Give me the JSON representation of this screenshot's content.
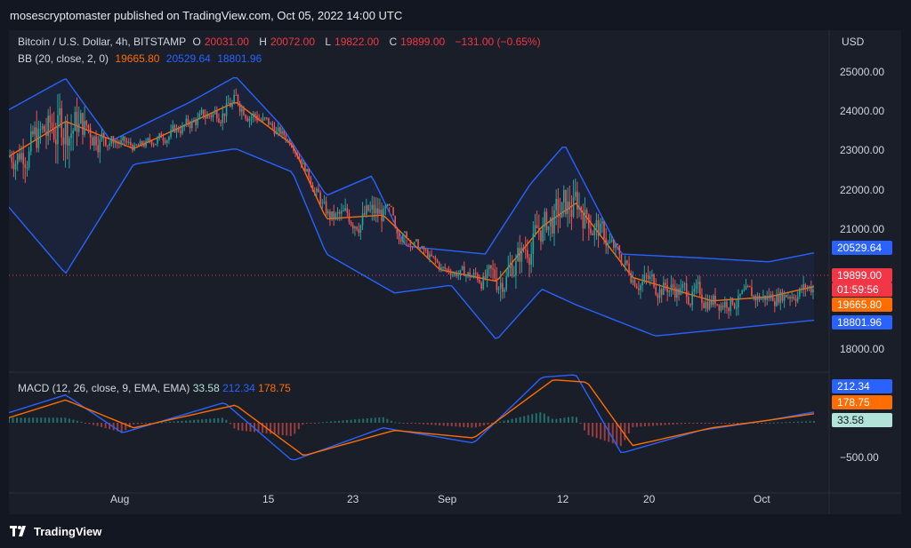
{
  "header": {
    "publisher_text": "mosescryptomaster published on TradingView.com, Oct 05, 2022 14:00 UTC"
  },
  "legend": {
    "symbol": "Bitcoin / U.S. Dollar, 4h, BITSTAMP",
    "open_label": "O",
    "open": "20031.00",
    "high_label": "H",
    "high": "20072.00",
    "low_label": "L",
    "low": "19822.00",
    "close_label": "C",
    "close": "19899.00",
    "change": "−131.00 (−0.65%)",
    "bb_label": "BB (20, close, 2, 0)",
    "bb_basis": "19665.80",
    "bb_upper": "20529.64",
    "bb_lower": "18801.96",
    "macd_label": "MACD (12, 26, close, 9, EMA, EMA)",
    "macd_hist": "33.58",
    "macd_line": "212.34",
    "macd_signal": "178.75"
  },
  "axis": {
    "currency": "USD",
    "price_ticks": [
      "25000.00",
      "24000.00",
      "23000.00",
      "22000.00",
      "21000.00",
      "18000.00"
    ],
    "macd_ticks": [
      "−500.00"
    ],
    "time_ticks": [
      "Aug",
      "15",
      "23",
      "Sep",
      "12",
      "20",
      "Oct"
    ]
  },
  "badges": {
    "bb_upper": "20529.64",
    "close": "19899.00",
    "countdown": "01:59:56",
    "bb_basis": "19665.80",
    "bb_lower": "18801.96",
    "macd_line": "212.34",
    "macd_signal": "178.75",
    "macd_hist": "33.58"
  },
  "footer": {
    "brand": "TradingView"
  },
  "colors": {
    "background": "#1a1e29",
    "band": "#2962ff",
    "basis": "#ff6d00",
    "up": "#26a69a",
    "down": "#ef5350",
    "macd": "#2962ff",
    "signal": "#ff6d00"
  },
  "chart_data": {
    "type": "candlestick",
    "symbol": "BTC/USD",
    "interval": "4h",
    "x_range": [
      "2022-07-26",
      "2022-10-05"
    ],
    "ylim": [
      17700,
      25600
    ],
    "indicators": {
      "bollinger_upper_approx": [
        [
          "2022-07-26",
          24200
        ],
        [
          "2022-07-31",
          25000
        ],
        [
          "2022-08-04",
          23400
        ],
        [
          "2022-08-11",
          24400
        ],
        [
          "2022-08-15",
          25050
        ],
        [
          "2022-08-19",
          23800
        ],
        [
          "2022-08-23",
          22000
        ],
        [
          "2022-08-27",
          22500
        ],
        [
          "2022-08-30",
          20700
        ],
        [
          "2022-09-06",
          20500
        ],
        [
          "2022-09-10",
          22300
        ],
        [
          "2022-09-13",
          23300
        ],
        [
          "2022-09-18",
          20500
        ],
        [
          "2022-09-25",
          20400
        ],
        [
          "2022-10-01",
          20300
        ],
        [
          "2022-10-05",
          20530
        ]
      ],
      "bollinger_basis_approx": [
        [
          "2022-07-26",
          23000
        ],
        [
          "2022-07-31",
          23900
        ],
        [
          "2022-08-06",
          23200
        ],
        [
          "2022-08-15",
          24400
        ],
        [
          "2022-08-20",
          23300
        ],
        [
          "2022-08-23",
          21400
        ],
        [
          "2022-08-28",
          21500
        ],
        [
          "2022-09-02",
          20100
        ],
        [
          "2022-09-07",
          19800
        ],
        [
          "2022-09-11",
          21200
        ],
        [
          "2022-09-14",
          21800
        ],
        [
          "2022-09-19",
          19900
        ],
        [
          "2022-09-26",
          19300
        ],
        [
          "2022-10-01",
          19400
        ],
        [
          "2022-10-05",
          19666
        ]
      ],
      "bollinger_lower_approx": [
        [
          "2022-07-26",
          21700
        ],
        [
          "2022-07-31",
          20000
        ],
        [
          "2022-08-06",
          22800
        ],
        [
          "2022-08-15",
          23200
        ],
        [
          "2022-08-20",
          22600
        ],
        [
          "2022-08-23",
          20500
        ],
        [
          "2022-08-29",
          19500
        ],
        [
          "2022-09-03",
          19700
        ],
        [
          "2022-09-07",
          18300
        ],
        [
          "2022-09-11",
          19600
        ],
        [
          "2022-09-14",
          19200
        ],
        [
          "2022-09-21",
          18400
        ],
        [
          "2022-09-28",
          18600
        ],
        [
          "2022-10-05",
          18802
        ]
      ],
      "macd_line_approx": [
        [
          "2022-07-26",
          200
        ],
        [
          "2022-07-31",
          550
        ],
        [
          "2022-08-05",
          -200
        ],
        [
          "2022-08-14",
          400
        ],
        [
          "2022-08-20",
          -750
        ],
        [
          "2022-08-28",
          -100
        ],
        [
          "2022-09-05",
          -400
        ],
        [
          "2022-09-11",
          900
        ],
        [
          "2022-09-14",
          950
        ],
        [
          "2022-09-18",
          -600
        ],
        [
          "2022-09-25",
          -150
        ],
        [
          "2022-10-01",
          50
        ],
        [
          "2022-10-05",
          212
        ]
      ],
      "macd_signal_approx": [
        [
          "2022-07-26",
          100
        ],
        [
          "2022-07-31",
          450
        ],
        [
          "2022-08-06",
          -100
        ],
        [
          "2022-08-15",
          350
        ],
        [
          "2022-08-21",
          -650
        ],
        [
          "2022-08-29",
          -150
        ],
        [
          "2022-09-05",
          -300
        ],
        [
          "2022-09-12",
          850
        ],
        [
          "2022-09-15",
          800
        ],
        [
          "2022-09-19",
          -450
        ],
        [
          "2022-09-26",
          -100
        ],
        [
          "2022-10-01",
          50
        ],
        [
          "2022-10-05",
          179
        ]
      ]
    },
    "last": {
      "open": 20031.0,
      "high": 20072.0,
      "low": 19822.0,
      "close": 19899.0,
      "change": -131.0,
      "change_pct": -0.65,
      "bb_basis": 19665.8,
      "bb_upper": 20529.64,
      "bb_lower": 18801.96,
      "macd": 212.34,
      "signal": 178.75,
      "histogram": 33.58
    },
    "grid": false,
    "legend_position": "top-left"
  }
}
